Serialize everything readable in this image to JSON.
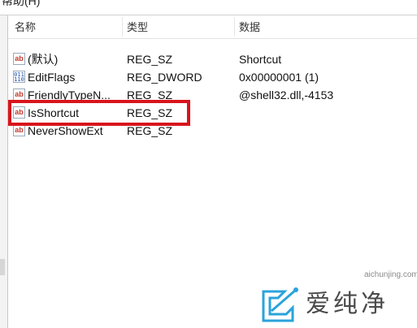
{
  "menubar": {
    "help_label": "帮助(H)"
  },
  "columns": {
    "name": "名称",
    "type": "类型",
    "data": "数据"
  },
  "rows": [
    {
      "name": "(默认)",
      "type": "REG_SZ",
      "data": "Shortcut",
      "icon": "string-value-icon"
    },
    {
      "name": "EditFlags",
      "type": "REG_DWORD",
      "data": "0x00000001 (1)",
      "icon": "binary-value-icon"
    },
    {
      "name": "FriendlyTypeN...",
      "type": "REG_SZ",
      "data": "@shell32.dll,-4153",
      "icon": "string-value-icon"
    },
    {
      "name": "IsShortcut",
      "type": "REG_SZ",
      "data": "",
      "icon": "string-value-icon"
    },
    {
      "name": "NeverShowExt",
      "type": "REG_SZ",
      "data": "",
      "icon": "string-value-icon"
    }
  ],
  "icons": {
    "string": "ab",
    "binary": "011\n110"
  },
  "watermark": {
    "text": "爱纯净",
    "url": "aichunjing.com"
  },
  "colors": {
    "highlight": "#d9141c",
    "watermark_blue": "#2aa3dc"
  }
}
